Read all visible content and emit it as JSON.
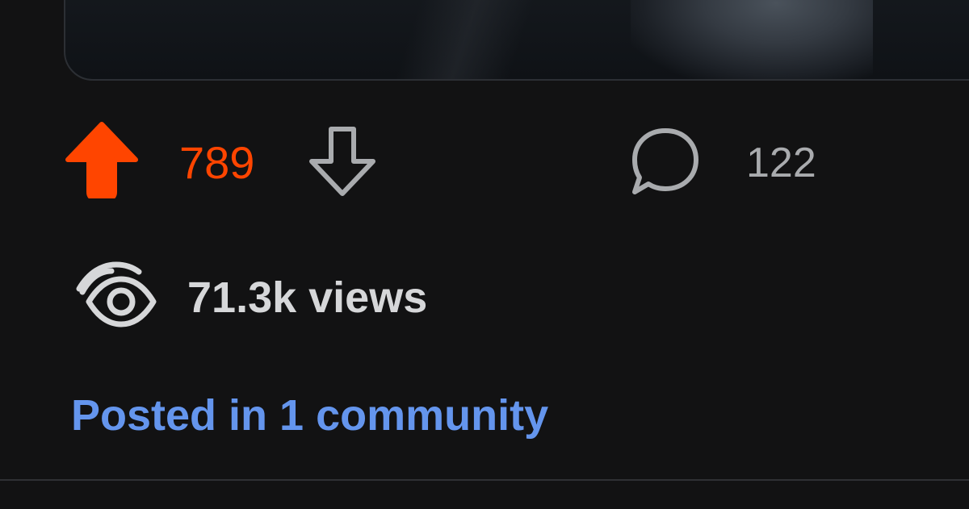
{
  "post": {
    "score": "789",
    "comment_count": "122",
    "views": "71.3k views",
    "posted_in": "Posted in 1 community"
  },
  "icons": {
    "upvote": "upvote-arrow-filled-icon",
    "downvote": "downvote-arrow-outline-icon",
    "comment": "speech-bubble-icon",
    "views": "eye-icon"
  },
  "colors": {
    "background": "#121213",
    "upvote_active": "#ff4500",
    "muted_text": "#a9abae",
    "views_text": "#d6d7d9",
    "link": "#6495ed"
  }
}
